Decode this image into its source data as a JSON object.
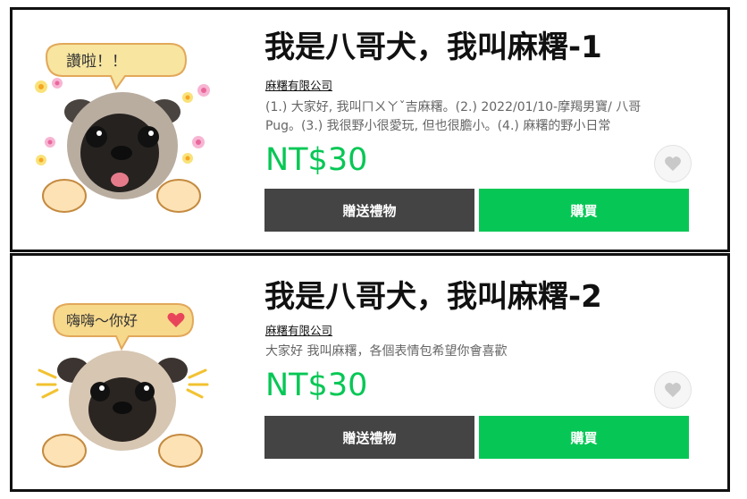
{
  "colors": {
    "accent": "#06c755",
    "dark_button": "#444444",
    "heart": "#cfcfcf"
  },
  "products": [
    {
      "title": "我是八哥犬，我叫麻糬-1",
      "author": "麻糬有限公司",
      "description": "(1.) 大家好, 我叫ㄇㄨㄚˇ吉麻糬。(2.) 2022/01/10-摩羯男寶/ 八哥 Pug。(3.) 我很野小很愛玩, 但也很膽小。(4.) 麻糬的野小日常",
      "price": "NT$30",
      "gift_label": "贈送禮物",
      "buy_label": "購買",
      "bubble_text": "讚啦！！"
    },
    {
      "title": "我是八哥犬，我叫麻糬-2",
      "author": "麻糬有限公司",
      "description": "大家好 我叫麻糬，各個表情包希望你會喜歡",
      "price": "NT$30",
      "gift_label": "贈送禮物",
      "buy_label": "購買",
      "bubble_text": "嗨嗨～你好"
    }
  ]
}
